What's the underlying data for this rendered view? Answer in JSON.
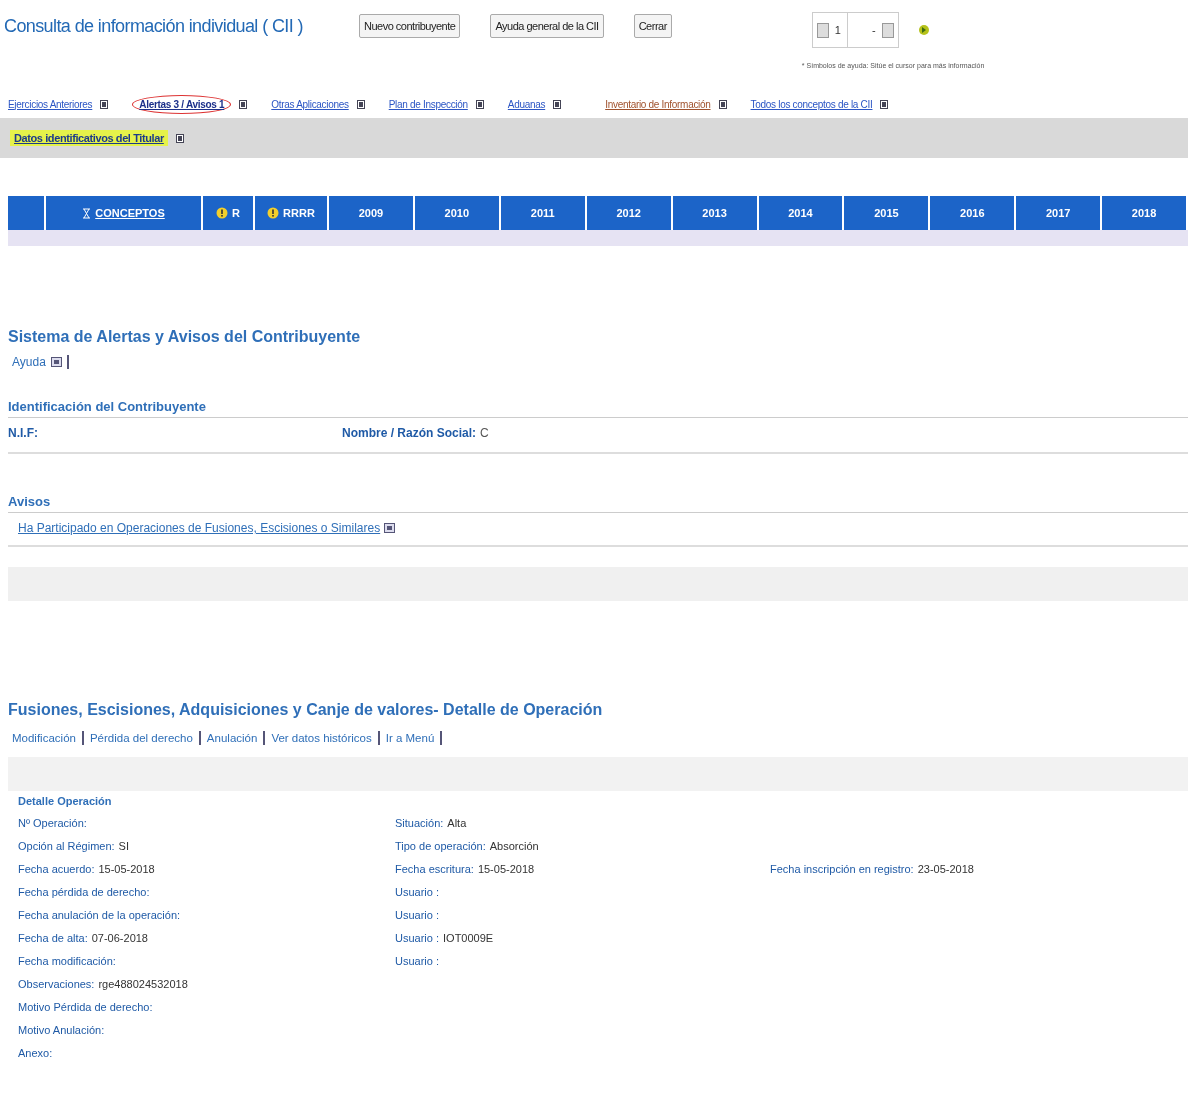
{
  "header": {
    "title": "Consulta de información individual ( CII )",
    "buttons": [
      "Nuevo contribuyente",
      "Ayuda general de la CII",
      "Cerrar"
    ],
    "pager": {
      "page": "1",
      "separator": "-"
    },
    "help_note": "* Símbolos de ayuda: Sitúe el cursor para más información"
  },
  "nav_links": [
    {
      "label": "Ejercicios Anteriores",
      "selected": false,
      "kind": "link"
    },
    {
      "label": "Alertas 3 / Avisos 1",
      "selected": true,
      "kind": "link"
    },
    {
      "label": "Otras Aplicaciones",
      "selected": false,
      "kind": "link"
    },
    {
      "label": "Plan de Inspección",
      "selected": false,
      "kind": "link"
    },
    {
      "label": "Aduanas",
      "selected": false,
      "kind": "link"
    },
    {
      "label": "Inventario de Información",
      "selected": false,
      "kind": "visited"
    },
    {
      "label": "Todos los conceptos de la CII",
      "selected": false,
      "kind": "link"
    }
  ],
  "titular_bar": {
    "label": "Datos identificativos del Titular"
  },
  "table": {
    "columns": [
      {
        "kind": "blank"
      },
      {
        "label": "CONCEPTOS",
        "kind": "concept"
      },
      {
        "label": "R",
        "kind": "alert"
      },
      {
        "label": "RRRR",
        "kind": "alert"
      },
      {
        "label": "2009",
        "kind": "year"
      },
      {
        "label": "2010",
        "kind": "year"
      },
      {
        "label": "2011",
        "kind": "year"
      },
      {
        "label": "2012",
        "kind": "year"
      },
      {
        "label": "2013",
        "kind": "year"
      },
      {
        "label": "2014",
        "kind": "year"
      },
      {
        "label": "2015",
        "kind": "year"
      },
      {
        "label": "2016",
        "kind": "year"
      },
      {
        "label": "2017",
        "kind": "year"
      },
      {
        "label": "2018",
        "kind": "year"
      }
    ]
  },
  "alerts": {
    "title": "Sistema de Alertas y Avisos del Contribuyente",
    "help_link": "Ayuda",
    "id_title": "Identificación del Contribuyente",
    "id_fields": [
      {
        "label": "N.I.F:"
      },
      {
        "label": "Nombre / Razón Social:",
        "value": "C"
      }
    ],
    "avisos_title": "Avisos",
    "avisos": [
      "Ha Participado en Operaciones de Fusiones, Escisiones o Similares"
    ]
  },
  "operation": {
    "title": "Fusiones, Escisiones, Adquisiciones y Canje de valores- Detalle de Operación",
    "actions": [
      "Modificación",
      "Pérdida del derecho",
      "Anulación",
      "Ver datos históricos",
      "Ir a Menú"
    ],
    "detail_title": "Detalle Operación",
    "columns": [
      [
        {
          "label": "Nº Operación:"
        },
        {
          "label": "Opción al Régimen:",
          "value": "SI"
        },
        {
          "label": "Fecha acuerdo:",
          "value": "15-05-2018"
        },
        {
          "label": "Fecha pérdida de derecho:"
        },
        {
          "label": "Fecha anulación de la operación:"
        },
        {
          "label": "Fecha de alta:",
          "value": "07-06-2018"
        },
        {
          "label": "Fecha modificación:"
        },
        {
          "label": "Observaciones:",
          "value": "rge488024532018"
        },
        {
          "label": "Motivo Pérdida de derecho:"
        },
        {
          "label": "Motivo Anulación:"
        },
        {
          "label": "Anexo:"
        }
      ],
      [
        {
          "label": "Situación:",
          "value": "Alta"
        },
        {
          "label": "Tipo de operación:",
          "value": "Absorción"
        },
        {
          "label": "Fecha escritura:",
          "value": "15-05-2018"
        },
        {
          "label": "Usuario :"
        },
        {
          "label": "Usuario :"
        },
        {
          "label": "Usuario :",
          "value": "IOT0009E"
        },
        {
          "label": "Usuario :"
        }
      ],
      [
        {
          "label": "Fecha inscripción en registro:",
          "value": "23-05-2018"
        }
      ]
    ]
  }
}
